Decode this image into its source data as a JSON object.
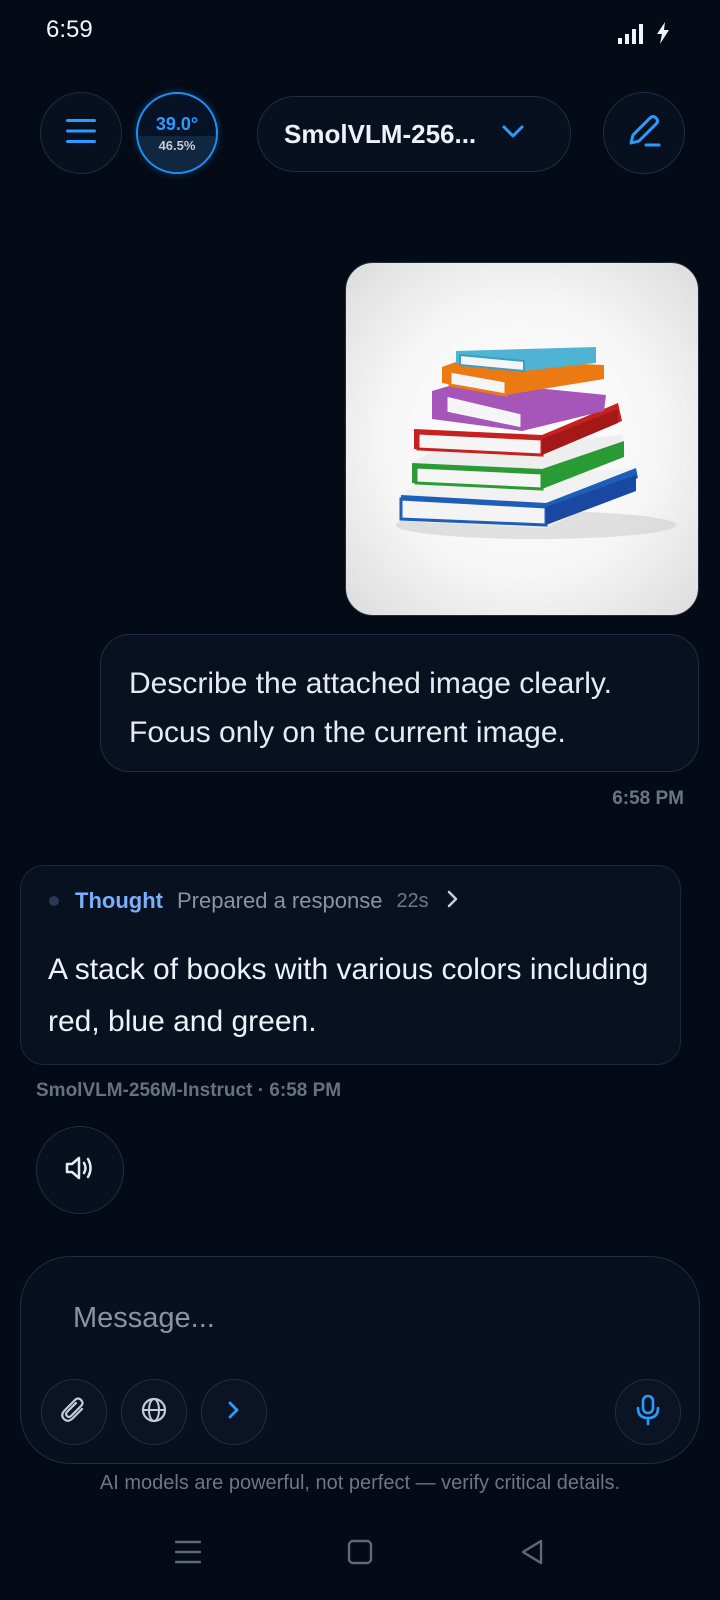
{
  "status_bar": {
    "time": "6:59",
    "icons": [
      "signal-icon",
      "charging-icon"
    ]
  },
  "header": {
    "menu_icon": "hamburger-menu-icon",
    "temperature": "39.0°",
    "usage_percent": "46.5%",
    "usage_fraction": 0.465,
    "model_name": "SmolVLM-256...",
    "model_dropdown_icon": "chevron-down-icon",
    "new_chat_icon": "pencil-icon"
  },
  "chat": {
    "user_message": {
      "image_description_icon": "books-stack-image",
      "text": "Describe the attached image clearly. Focus only on the current image.",
      "time": "6:58 PM"
    },
    "assistant_message": {
      "thought_label": "Thought",
      "thought_status": "Prepared a response",
      "thought_duration": "22s",
      "text": "A stack of books with various colors including red, blue and green.",
      "meta": "SmolVLM-256M-Instruct · 6:58 PM",
      "speak_icon": "speaker-icon"
    }
  },
  "composer": {
    "placeholder": "Message...",
    "tools": [
      "paperclip-icon",
      "globe-icon",
      "chevron-right-icon"
    ],
    "mic_icon": "microphone-icon",
    "disclaimer": "AI models are powerful, not perfect — verify critical details."
  },
  "nav_bar": {
    "icons": [
      "recent-apps-icon",
      "home-icon",
      "back-icon"
    ]
  },
  "colors": {
    "background": "#040a16",
    "accent": "#1f8ff0",
    "thought_accent": "#7ab0ff"
  }
}
